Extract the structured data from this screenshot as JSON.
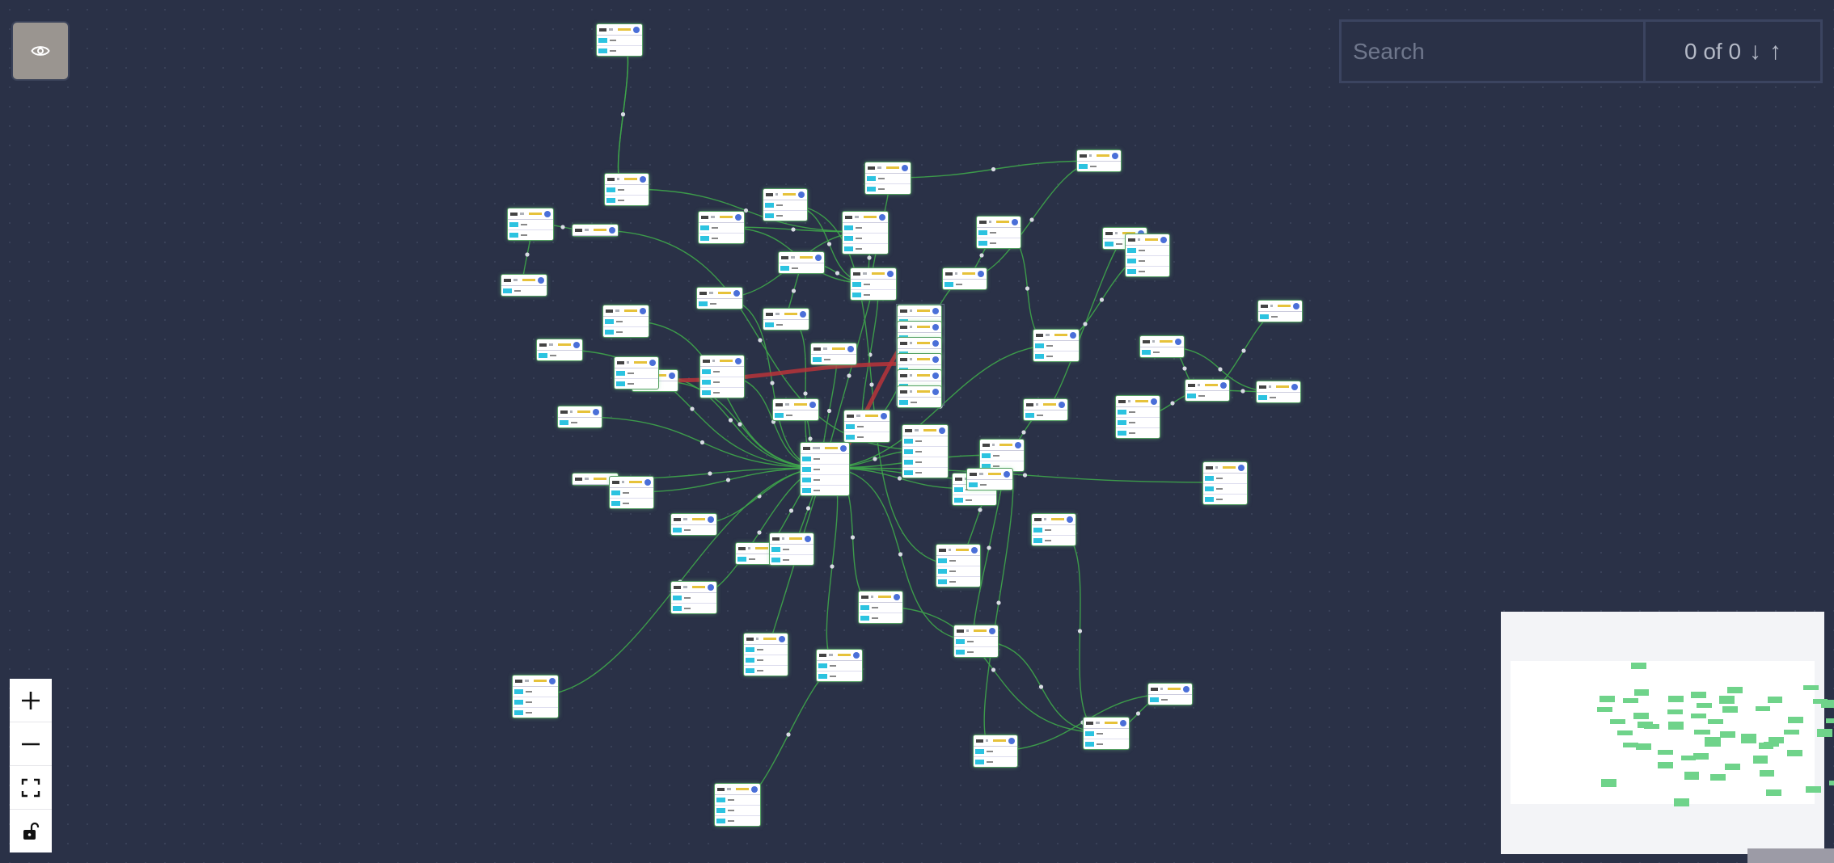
{
  "toolbar": {
    "visibility_toggle_icon": "eye-icon"
  },
  "search": {
    "placeholder": "Search",
    "value": "",
    "match_counter": "0 of 0",
    "next_icon": "arrow-down-icon",
    "prev_icon": "arrow-up-icon",
    "next_glyph": "↓",
    "prev_glyph": "↑"
  },
  "controls": [
    {
      "name": "zoom-in",
      "icon": "plus-icon"
    },
    {
      "name": "zoom-out",
      "icon": "minus-icon"
    },
    {
      "name": "fit-view",
      "icon": "fullscreen-icon"
    },
    {
      "name": "toggle-interactivity",
      "icon": "unlock-icon"
    }
  ],
  "colors": {
    "canvas": "#2a3147",
    "edge": "#3ea64a",
    "edge_highlight": "#b8343a",
    "port_tag": "#2cc3e0",
    "badge": "#e6c23a",
    "node_icon": "#4a6fd8",
    "minimap_node": "#6fd38a"
  },
  "graph": {
    "node_ports": [
      2,
      2,
      2,
      0,
      1,
      2,
      2,
      3,
      2,
      1,
      1,
      2,
      1,
      2,
      1,
      2,
      1,
      1,
      1,
      1,
      2,
      1,
      3,
      1,
      1,
      1,
      1,
      1,
      1,
      2,
      1,
      4,
      4,
      2,
      0,
      1,
      2,
      1,
      3,
      2,
      3,
      2,
      2,
      3,
      2,
      3,
      2,
      2,
      1,
      3,
      2,
      2,
      3,
      2,
      1,
      2,
      3
    ]
  }
}
